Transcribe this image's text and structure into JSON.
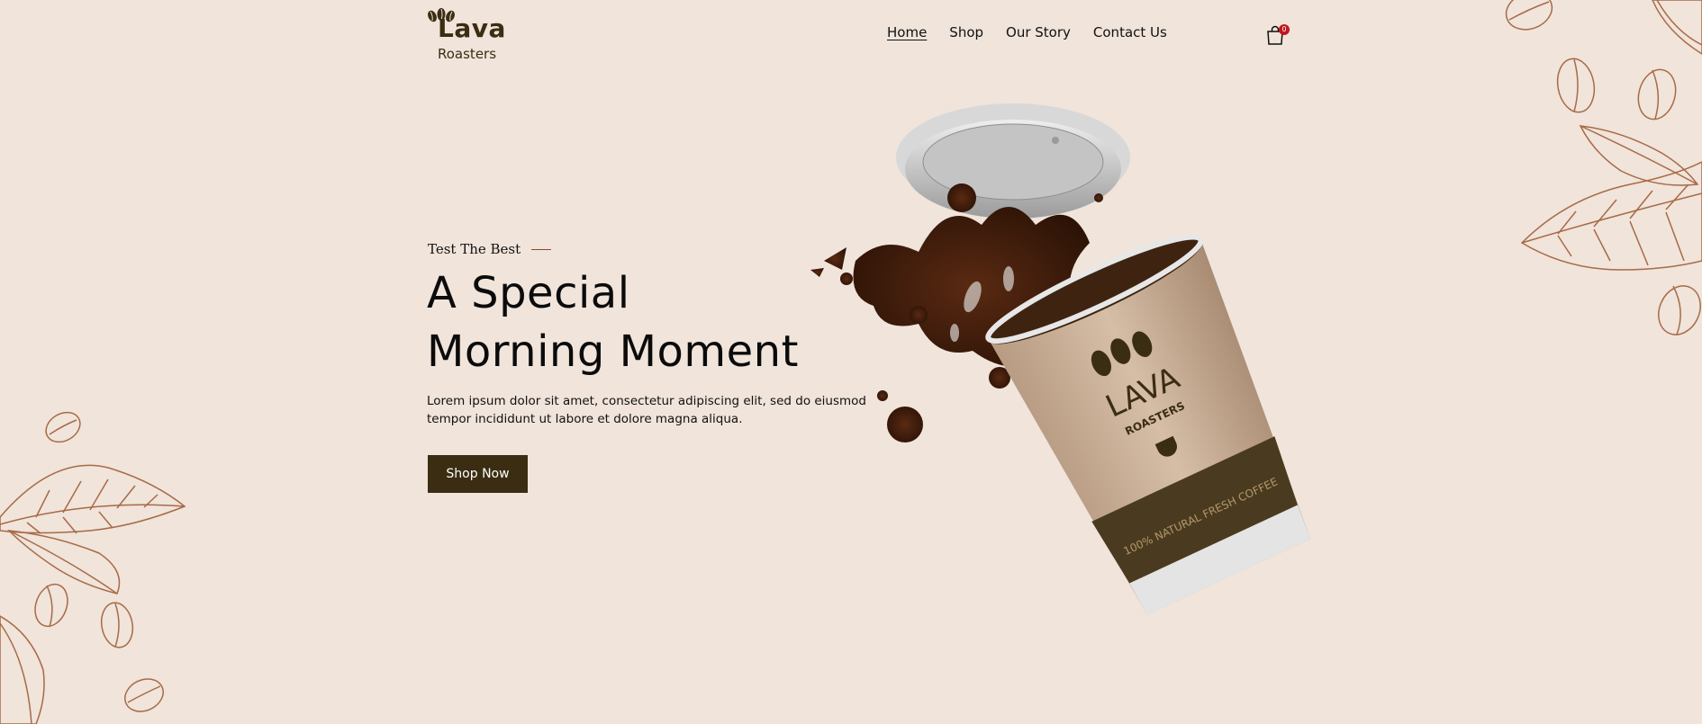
{
  "brand": {
    "name": "Lava",
    "tagline": "Roasters"
  },
  "nav": {
    "items": [
      {
        "label": "Home",
        "active": true
      },
      {
        "label": "Shop",
        "active": false
      },
      {
        "label": "Our Story",
        "active": false
      },
      {
        "label": "Contact Us",
        "active": false
      }
    ]
  },
  "cart": {
    "icon": "shopping-bag-icon",
    "count": "0"
  },
  "hero": {
    "eyebrow": "Test The Best",
    "title_line1": "A Special",
    "title_line2": "Morning Moment",
    "description_line1": "Lorem ipsum dolor sit amet, consectetur adipiscing elit, sed do eiusmod",
    "description_line2": "tempor incididunt ut labore et dolore magna aliqua.",
    "cta": "Shop Now"
  },
  "product": {
    "cup_brand": "LAVA",
    "cup_sub": "ROASTERS",
    "cup_band": "100% NATURAL FRESH COFFEE"
  },
  "colors": {
    "background": "#f0e4db",
    "brand_dark": "#3b2d12",
    "accent_line": "#8a4d2a",
    "badge": "#c1161c",
    "illustration": "#a86a45"
  }
}
